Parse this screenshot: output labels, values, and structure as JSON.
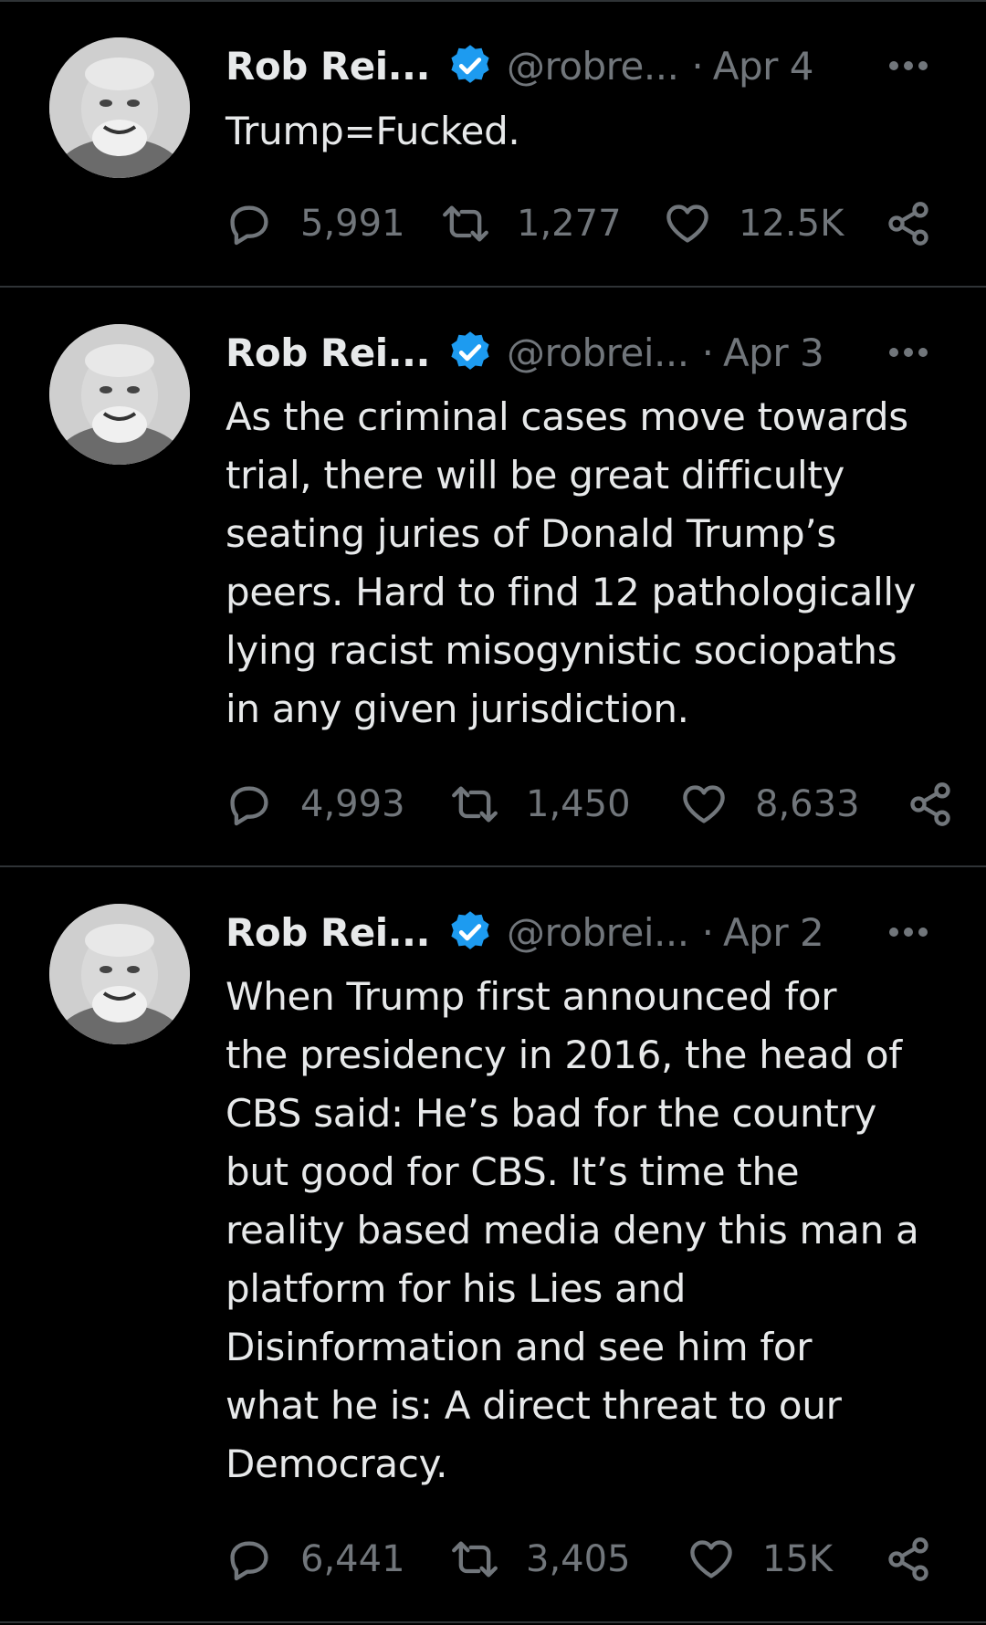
{
  "tweets": [
    {
      "author": {
        "name": "Rob Rei...",
        "handle": "@robre...",
        "verified": true
      },
      "separator": "·",
      "date": "Apr 4",
      "text": "Trump=Fucked.",
      "stats": {
        "replies": "5,991",
        "reposts": "1,277",
        "likes": "12.5K"
      }
    },
    {
      "author": {
        "name": "Rob Rei...",
        "handle": "@robrei...",
        "verified": true
      },
      "separator": "·",
      "date": "Apr 3",
      "text": "As the criminal cases move towards\ntrial, there will be great difficulty\nseating juries of Donald Trump’s\npeers. Hard to find 12 pathologically\nlying racist misogynistic sociopaths\nin any given jurisdiction.",
      "stats": {
        "replies": "4,993",
        "reposts": "1,450",
        "likes": "8,633"
      }
    },
    {
      "author": {
        "name": "Rob Rei...",
        "handle": "@robrei...",
        "verified": true
      },
      "separator": "·",
      "date": "Apr 2",
      "text": "When Trump first announced for\nthe presidency in 2016, the head of\nCBS said: He’s bad for the country\nbut good for CBS. It’s time the\nreality based media deny this man a\nplatform for his Lies and\nDisinformation and see him for\nwhat he is: A direct threat to our\nDemocracy.",
      "stats": {
        "replies": "6,441",
        "reposts": "3,405",
        "likes": "15K"
      }
    }
  ],
  "icons": {
    "verified": "verified-badge-icon",
    "more": "more-options-icon",
    "reply": "reply-icon",
    "repost": "repost-icon",
    "like": "heart-icon",
    "share": "share-icon"
  },
  "colors": {
    "background": "#000000",
    "text": "#e7e9ea",
    "secondary_text": "#71767b",
    "verified_blue": "#1d9bf0",
    "divider": "#2f3336"
  }
}
